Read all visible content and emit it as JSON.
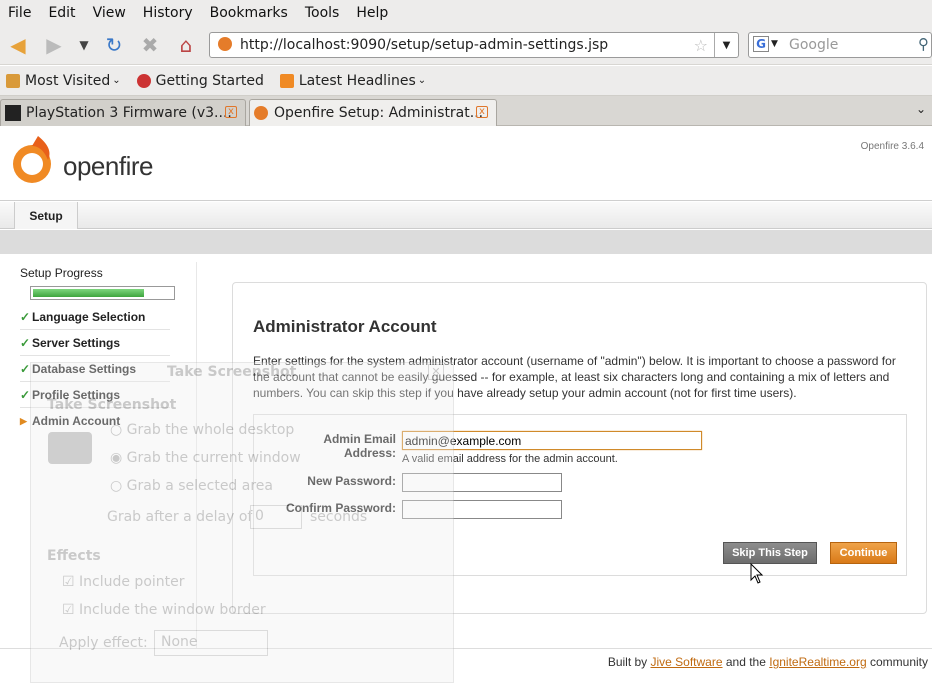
{
  "menubar": {
    "items": [
      "File",
      "Edit",
      "View",
      "History",
      "Bookmarks",
      "Tools",
      "Help"
    ]
  },
  "nav": {
    "url": "http://localhost:9090/setup/setup-admin-settings.jsp",
    "search_placeholder": "Google"
  },
  "bookmarks": {
    "items": [
      "Most Visited",
      "Getting Started",
      "Latest Headlines"
    ]
  },
  "tabs": [
    {
      "label": "PlayStation 3 Firmware (v3...."
    },
    {
      "label": "Openfire Setup: Administrat..."
    }
  ],
  "openfire": {
    "logo_text": "openfire",
    "version": "Openfire 3.6.4",
    "nav_tab": "Setup"
  },
  "sidebar": {
    "progress_title": "Setup Progress",
    "progress_fraction": 0.8,
    "steps": [
      {
        "label": "Language Selection",
        "status": "done"
      },
      {
        "label": "Server Settings",
        "status": "done"
      },
      {
        "label": "Database Settings",
        "status": "done"
      },
      {
        "label": "Profile Settings",
        "status": "done"
      },
      {
        "label": "Admin Account",
        "status": "current"
      }
    ]
  },
  "panel": {
    "title": "Administrator Account",
    "description": "Enter settings for the system administrator account (username of \"admin\") below. It is important to choose a password for the account that cannot be easily guessed -- for example, at least six characters long and containing a mix of letters and numbers. You can skip this step if you have already setup your admin account (not for first time users).",
    "email_label": "Admin Email Address:",
    "email_value": "admin@example.com",
    "email_hint": "A valid email address for the admin account.",
    "new_password_label": "New Password:",
    "confirm_password_label": "Confirm Password:",
    "skip_label": "Skip This Step",
    "continue_label": "Continue"
  },
  "footer": {
    "prefix": "Built by ",
    "link1": "Jive Software",
    "middle": " and the ",
    "link2": "IgniteRealtime.org",
    "suffix": " community"
  },
  "ghost_dialog": {
    "window_title": "Take Screenshot",
    "heading": "Take Screenshot",
    "option1": "Grab the whole desktop",
    "option2": "Grab the current window",
    "option3": "Grab a selected area",
    "delay_label": "Grab after a delay of",
    "delay_value": "0",
    "delay_unit": "seconds",
    "effects_heading": "Effects",
    "effect1": "Include pointer",
    "effect2": "Include the window border",
    "apply_label": "Apply effect:",
    "apply_value": "None"
  }
}
